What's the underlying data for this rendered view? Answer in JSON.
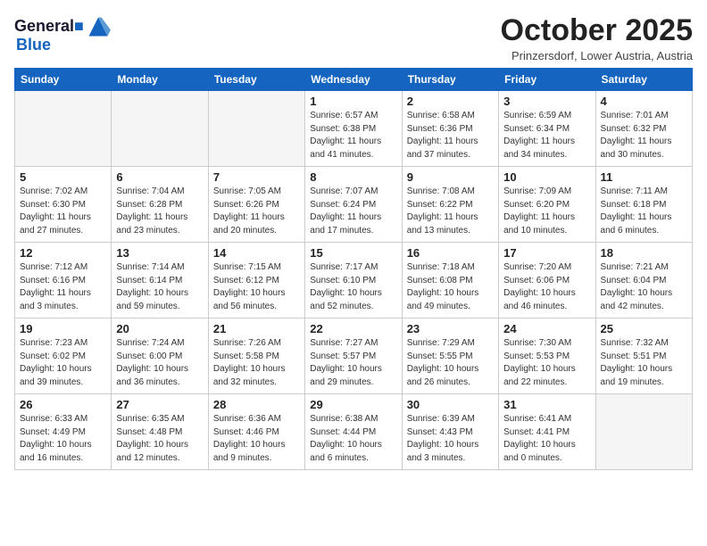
{
  "header": {
    "logo_line1": "General",
    "logo_line2": "Blue",
    "month": "October 2025",
    "location": "Prinzersdorf, Lower Austria, Austria"
  },
  "days_of_week": [
    "Sunday",
    "Monday",
    "Tuesday",
    "Wednesday",
    "Thursday",
    "Friday",
    "Saturday"
  ],
  "weeks": [
    [
      {
        "day": "",
        "info": ""
      },
      {
        "day": "",
        "info": ""
      },
      {
        "day": "",
        "info": ""
      },
      {
        "day": "1",
        "info": "Sunrise: 6:57 AM\nSunset: 6:38 PM\nDaylight: 11 hours\nand 41 minutes."
      },
      {
        "day": "2",
        "info": "Sunrise: 6:58 AM\nSunset: 6:36 PM\nDaylight: 11 hours\nand 37 minutes."
      },
      {
        "day": "3",
        "info": "Sunrise: 6:59 AM\nSunset: 6:34 PM\nDaylight: 11 hours\nand 34 minutes."
      },
      {
        "day": "4",
        "info": "Sunrise: 7:01 AM\nSunset: 6:32 PM\nDaylight: 11 hours\nand 30 minutes."
      }
    ],
    [
      {
        "day": "5",
        "info": "Sunrise: 7:02 AM\nSunset: 6:30 PM\nDaylight: 11 hours\nand 27 minutes."
      },
      {
        "day": "6",
        "info": "Sunrise: 7:04 AM\nSunset: 6:28 PM\nDaylight: 11 hours\nand 23 minutes."
      },
      {
        "day": "7",
        "info": "Sunrise: 7:05 AM\nSunset: 6:26 PM\nDaylight: 11 hours\nand 20 minutes."
      },
      {
        "day": "8",
        "info": "Sunrise: 7:07 AM\nSunset: 6:24 PM\nDaylight: 11 hours\nand 17 minutes."
      },
      {
        "day": "9",
        "info": "Sunrise: 7:08 AM\nSunset: 6:22 PM\nDaylight: 11 hours\nand 13 minutes."
      },
      {
        "day": "10",
        "info": "Sunrise: 7:09 AM\nSunset: 6:20 PM\nDaylight: 11 hours\nand 10 minutes."
      },
      {
        "day": "11",
        "info": "Sunrise: 7:11 AM\nSunset: 6:18 PM\nDaylight: 11 hours\nand 6 minutes."
      }
    ],
    [
      {
        "day": "12",
        "info": "Sunrise: 7:12 AM\nSunset: 6:16 PM\nDaylight: 11 hours\nand 3 minutes."
      },
      {
        "day": "13",
        "info": "Sunrise: 7:14 AM\nSunset: 6:14 PM\nDaylight: 10 hours\nand 59 minutes."
      },
      {
        "day": "14",
        "info": "Sunrise: 7:15 AM\nSunset: 6:12 PM\nDaylight: 10 hours\nand 56 minutes."
      },
      {
        "day": "15",
        "info": "Sunrise: 7:17 AM\nSunset: 6:10 PM\nDaylight: 10 hours\nand 52 minutes."
      },
      {
        "day": "16",
        "info": "Sunrise: 7:18 AM\nSunset: 6:08 PM\nDaylight: 10 hours\nand 49 minutes."
      },
      {
        "day": "17",
        "info": "Sunrise: 7:20 AM\nSunset: 6:06 PM\nDaylight: 10 hours\nand 46 minutes."
      },
      {
        "day": "18",
        "info": "Sunrise: 7:21 AM\nSunset: 6:04 PM\nDaylight: 10 hours\nand 42 minutes."
      }
    ],
    [
      {
        "day": "19",
        "info": "Sunrise: 7:23 AM\nSunset: 6:02 PM\nDaylight: 10 hours\nand 39 minutes."
      },
      {
        "day": "20",
        "info": "Sunrise: 7:24 AM\nSunset: 6:00 PM\nDaylight: 10 hours\nand 36 minutes."
      },
      {
        "day": "21",
        "info": "Sunrise: 7:26 AM\nSunset: 5:58 PM\nDaylight: 10 hours\nand 32 minutes."
      },
      {
        "day": "22",
        "info": "Sunrise: 7:27 AM\nSunset: 5:57 PM\nDaylight: 10 hours\nand 29 minutes."
      },
      {
        "day": "23",
        "info": "Sunrise: 7:29 AM\nSunset: 5:55 PM\nDaylight: 10 hours\nand 26 minutes."
      },
      {
        "day": "24",
        "info": "Sunrise: 7:30 AM\nSunset: 5:53 PM\nDaylight: 10 hours\nand 22 minutes."
      },
      {
        "day": "25",
        "info": "Sunrise: 7:32 AM\nSunset: 5:51 PM\nDaylight: 10 hours\nand 19 minutes."
      }
    ],
    [
      {
        "day": "26",
        "info": "Sunrise: 6:33 AM\nSunset: 4:49 PM\nDaylight: 10 hours\nand 16 minutes."
      },
      {
        "day": "27",
        "info": "Sunrise: 6:35 AM\nSunset: 4:48 PM\nDaylight: 10 hours\nand 12 minutes."
      },
      {
        "day": "28",
        "info": "Sunrise: 6:36 AM\nSunset: 4:46 PM\nDaylight: 10 hours\nand 9 minutes."
      },
      {
        "day": "29",
        "info": "Sunrise: 6:38 AM\nSunset: 4:44 PM\nDaylight: 10 hours\nand 6 minutes."
      },
      {
        "day": "30",
        "info": "Sunrise: 6:39 AM\nSunset: 4:43 PM\nDaylight: 10 hours\nand 3 minutes."
      },
      {
        "day": "31",
        "info": "Sunrise: 6:41 AM\nSunset: 4:41 PM\nDaylight: 10 hours\nand 0 minutes."
      },
      {
        "day": "",
        "info": ""
      }
    ]
  ]
}
